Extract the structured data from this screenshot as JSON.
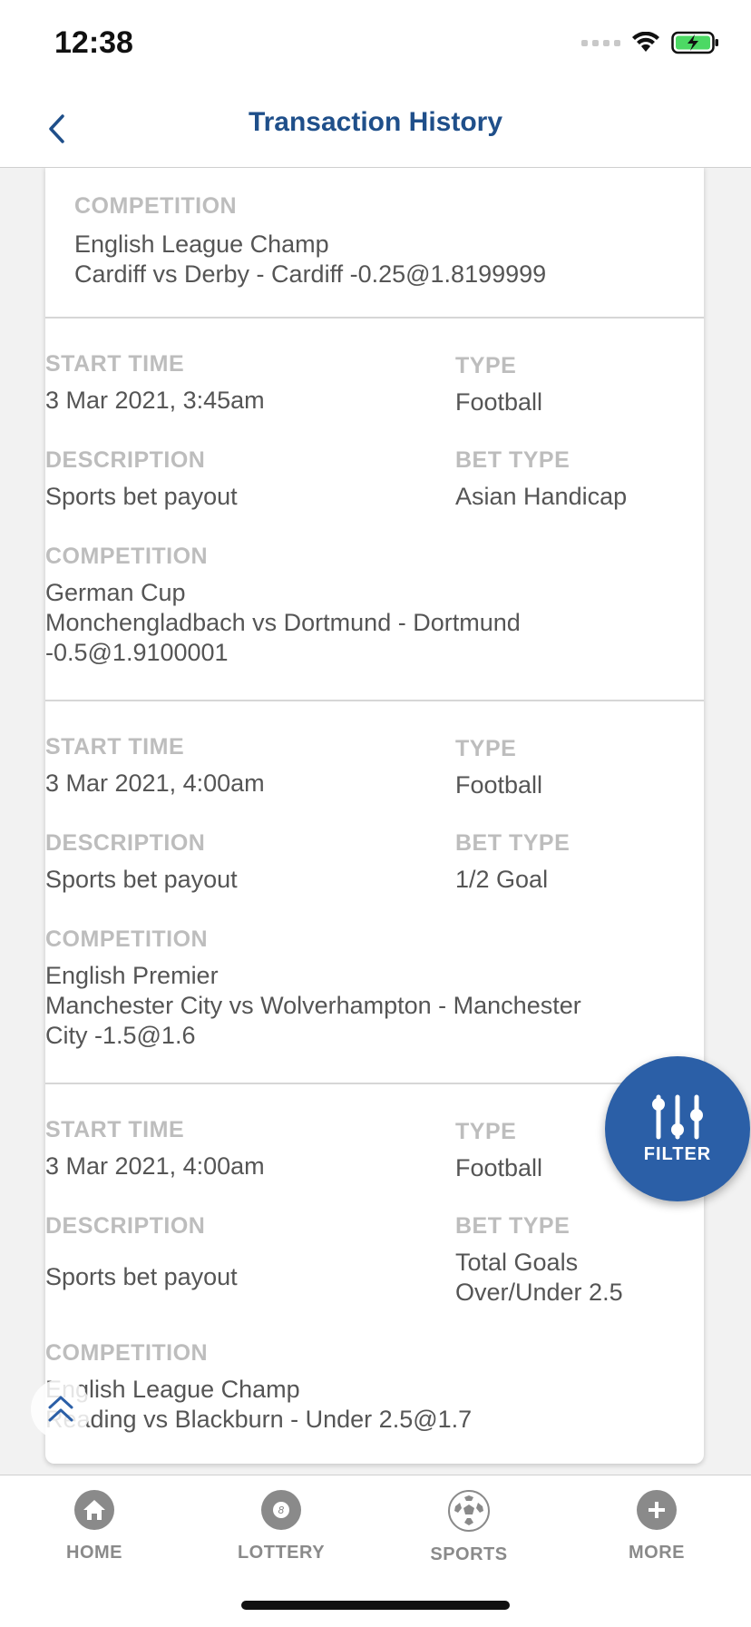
{
  "status_bar": {
    "time": "12:38"
  },
  "header": {
    "title": "Transaction History"
  },
  "labels": {
    "start_time": "START TIME",
    "type": "TYPE",
    "description": "DESCRIPTION",
    "bet_type": "BET TYPE",
    "competition": "COMPETITION"
  },
  "records": [
    {
      "competition_line1": "English League Champ",
      "competition_line2": "Cardiff vs Derby - Cardiff -0.25@1.8199999"
    },
    {
      "start_time": "3 Mar 2021, 3:45am",
      "type": "Football",
      "description": "Sports bet payout",
      "bet_type": "Asian Handicap",
      "competition_line1": "German Cup",
      "competition_line2": "Monchengladbach vs Dortmund - Dortmund",
      "competition_line3": "-0.5@1.9100001"
    },
    {
      "start_time": "3 Mar 2021, 4:00am",
      "type": "Football",
      "description": "Sports bet payout",
      "bet_type": "1/2 Goal",
      "competition_line1": "English Premier",
      "competition_line2": "Manchester City vs Wolverhampton - Manchester",
      "competition_line3": "City -1.5@1.6"
    },
    {
      "start_time": "3 Mar 2021, 4:00am",
      "type": "Football",
      "description": "Sports bet payout",
      "bet_type_line1": "Total Goals",
      "bet_type_line2": "Over/Under 2.5",
      "competition_line1": "English League Champ",
      "competition_line2": "Reading vs Blackburn - Under 2.5@1.7"
    }
  ],
  "fab": {
    "label": "FILTER"
  },
  "tabs": [
    {
      "label": "HOME",
      "icon": "home-icon"
    },
    {
      "label": "LOTTERY",
      "icon": "lottery-ball-icon"
    },
    {
      "label": "SPORTS",
      "icon": "soccer-ball-icon"
    },
    {
      "label": "MORE",
      "icon": "plus-icon"
    }
  ],
  "colors": {
    "accent": "#1f4f8a",
    "fab": "#2b5fa7",
    "battery": "#4cd964"
  }
}
